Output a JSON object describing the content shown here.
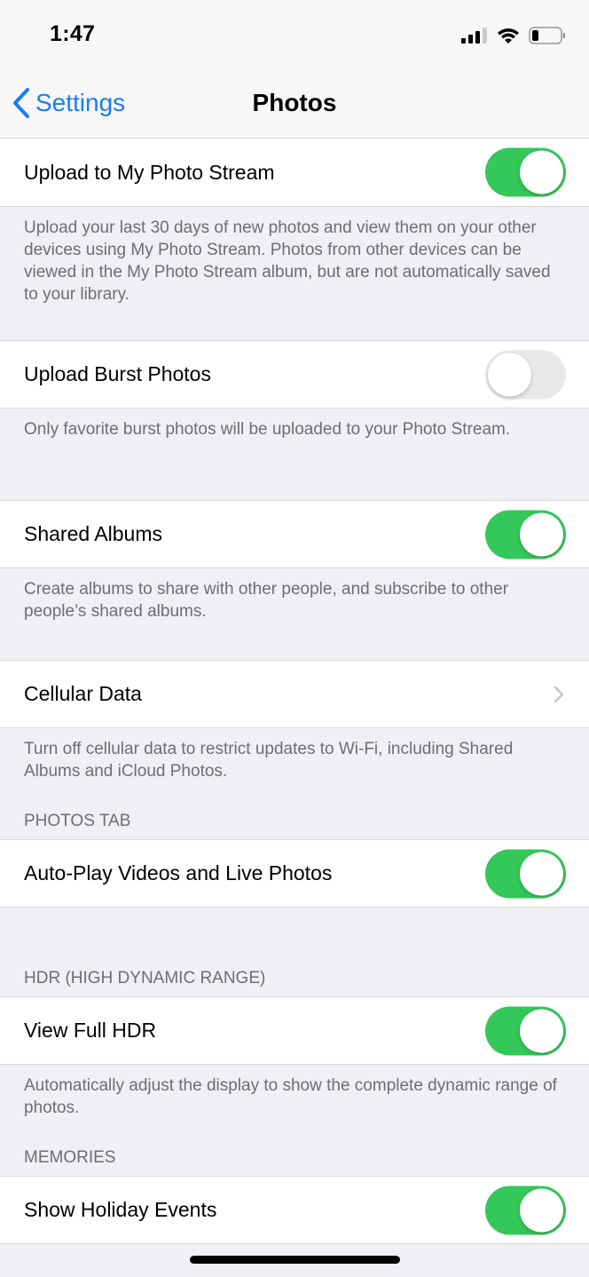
{
  "status_bar": {
    "time": "1:47",
    "signal_icon": "cellular-signal-icon",
    "wifi_icon": "wifi-icon",
    "battery_icon": "battery-low-icon"
  },
  "nav": {
    "back_label": "Settings",
    "title": "Photos"
  },
  "colors": {
    "accent": "#1a7cf5",
    "toggle_on": "#34c759",
    "toggle_off": "#e9e9eb",
    "background": "#efeff4"
  },
  "sections": [
    {
      "rows": [
        {
          "label": "Upload to My Photo Stream",
          "type": "toggle",
          "on": true
        }
      ],
      "footer": "Upload your last 30 days of new photos and view them on your other devices using My Photo Stream. Photos from other devices can be viewed in the My Photo Stream album, but are not automatically saved to your library."
    },
    {
      "rows": [
        {
          "label": "Upload Burst Photos",
          "type": "toggle",
          "on": false
        }
      ],
      "footer": "Only favorite burst photos will be uploaded to your Photo Stream."
    },
    {
      "rows": [
        {
          "label": "Shared Albums",
          "type": "toggle",
          "on": true
        }
      ],
      "footer": "Create albums to share with other people, and subscribe to other people’s shared albums."
    },
    {
      "rows": [
        {
          "label": "Cellular Data",
          "type": "disclosure"
        }
      ],
      "footer": "Turn off cellular data to restrict updates to Wi-Fi, including Shared Albums and iCloud Photos."
    },
    {
      "header": "PHOTOS TAB",
      "rows": [
        {
          "label": "Auto-Play Videos and Live Photos",
          "type": "toggle",
          "on": true
        }
      ]
    },
    {
      "header": "HDR (HIGH DYNAMIC RANGE)",
      "rows": [
        {
          "label": "View Full HDR",
          "type": "toggle",
          "on": true
        }
      ],
      "footer": "Automatically adjust the display to show the complete dynamic range of photos."
    },
    {
      "header": "MEMORIES",
      "rows": [
        {
          "label": "Show Holiday Events",
          "type": "toggle",
          "on": true
        }
      ]
    }
  ]
}
